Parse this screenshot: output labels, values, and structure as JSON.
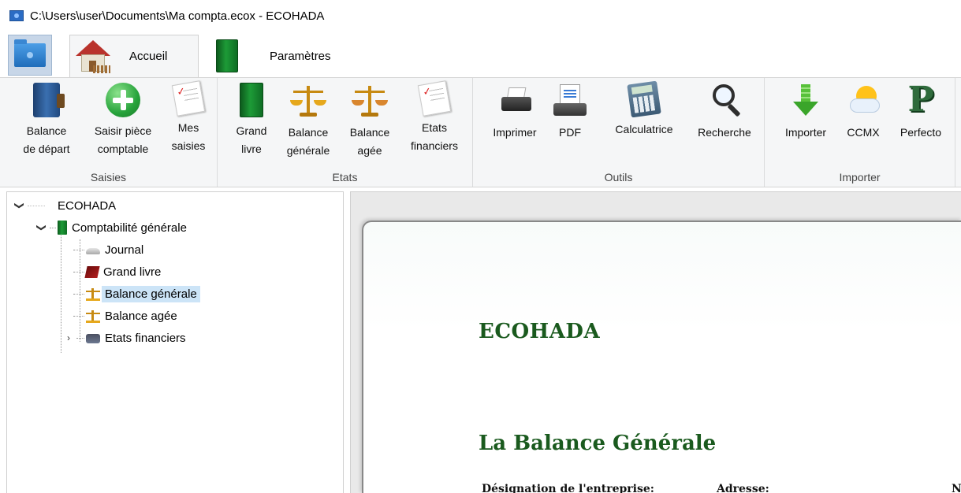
{
  "window": {
    "title": "C:\\Users\\user\\Documents\\Ma compta.ecox - ECOHADA"
  },
  "ribbon_tabs": {
    "file_icon": "folder-icon",
    "home": "Accueil",
    "settings": "Paramètres"
  },
  "groups": {
    "saisies": {
      "label": "Saisies",
      "buttons": [
        {
          "label": "Balance\nde départ",
          "icon": "ledger-icon"
        },
        {
          "label": "Saisir pièce\ncomptable",
          "icon": "plus-circle-icon"
        },
        {
          "label": "Mes\nsaisies",
          "icon": "checklist-icon"
        }
      ]
    },
    "etats": {
      "label": "Etats",
      "buttons": [
        {
          "label": "Grand\nlivre",
          "icon": "green-book-icon"
        },
        {
          "label": "Balance\ngénérale",
          "icon": "scale-icon"
        },
        {
          "label": "Balance\nagée",
          "icon": "scale-icon"
        },
        {
          "label": "Etats\nfinanciers",
          "icon": "checklist-icon"
        }
      ]
    },
    "outils": {
      "label": "Outils",
      "buttons": [
        {
          "label": "Imprimer",
          "icon": "printer-icon"
        },
        {
          "label": "PDF",
          "icon": "pdf-printer-icon"
        },
        {
          "label": "Calculatrice",
          "icon": "calculator-icon"
        },
        {
          "label": "Recherche",
          "icon": "magnifier-icon"
        }
      ]
    },
    "importer": {
      "label": "Importer",
      "buttons": [
        {
          "label": "Importer",
          "icon": "download-arrow-icon"
        },
        {
          "label": "CCMX",
          "icon": "sun-cloud-icon"
        },
        {
          "label": "Perfecto",
          "icon": "perfecto-p-icon"
        }
      ]
    }
  },
  "tree": {
    "root": "ECOHADA",
    "section": "Comptabilité générale",
    "items": [
      "Journal",
      "Grand livre",
      "Balance générale",
      "Balance agée",
      "Etats financiers"
    ],
    "selected": "Balance générale"
  },
  "document": {
    "company": "ECOHADA",
    "title": "La Balance Générale",
    "field_designation": "Désignation de l'entreprise:",
    "field_address": "Adresse:",
    "field_cut": "N"
  },
  "colors": {
    "accent_green": "#1a5a1e",
    "selection": "#cce4f7",
    "ribbon_bg": "#f5f6f7"
  }
}
